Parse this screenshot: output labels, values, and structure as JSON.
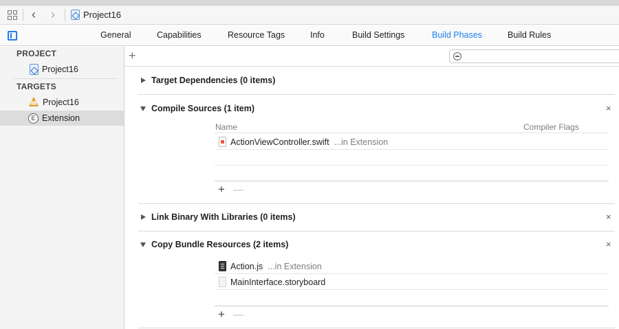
{
  "jumpbar": {
    "title": "Project16",
    "icons": {
      "grid": "related-items-grid-icon",
      "back": "chevron-left-icon",
      "forward": "chevron-right-icon",
      "file": "xcode-project-icon"
    }
  },
  "tabs": [
    {
      "label": "General",
      "active": false
    },
    {
      "label": "Capabilities",
      "active": false
    },
    {
      "label": "Resource Tags",
      "active": false
    },
    {
      "label": "Info",
      "active": false
    },
    {
      "label": "Build Settings",
      "active": false
    },
    {
      "label": "Build Phases",
      "active": true
    },
    {
      "label": "Build Rules",
      "active": false
    }
  ],
  "sidebar": {
    "project_header": "PROJECT",
    "project_item": "Project16",
    "targets_header": "TARGETS",
    "targets": [
      {
        "label": "Project16",
        "icon": "app-target-icon",
        "selected": false
      },
      {
        "label": "Extension",
        "icon": "extension-target-icon",
        "selected": true
      }
    ]
  },
  "main": {
    "add_label": "+",
    "filter_placeholder": "",
    "phases": [
      {
        "title": "Target Dependencies (0 items)",
        "expanded": false,
        "closable": false
      },
      {
        "title": "Compile Sources (1 item)",
        "expanded": true,
        "closable": true,
        "columns": [
          "Name",
          "Compiler Flags"
        ],
        "rows": [
          {
            "name": "ActionViewController.swift",
            "location": "...in Extension",
            "icon": "swift-file-icon"
          }
        ],
        "add_label": "+",
        "remove_label": "—"
      },
      {
        "title": "Link Binary With Libraries (0 items)",
        "expanded": false,
        "closable": true
      },
      {
        "title": "Copy Bundle Resources (2 items)",
        "expanded": true,
        "closable": true,
        "rows": [
          {
            "name": "Action.js",
            "location": "...in Extension",
            "icon": "javascript-file-icon"
          },
          {
            "name": "MainInterface.storyboard",
            "location": "",
            "icon": "storyboard-file-icon"
          }
        ],
        "add_label": "+",
        "remove_label": "—"
      }
    ],
    "close_glyph": "×"
  },
  "colors": {
    "accent": "#1e7ff0",
    "selection": "#dcdcdc",
    "sidebar_bg": "#f4f4f4"
  }
}
